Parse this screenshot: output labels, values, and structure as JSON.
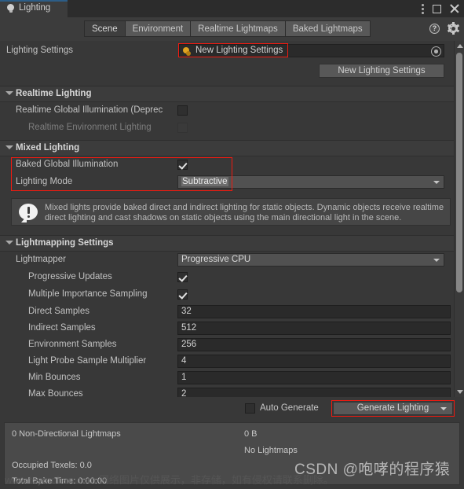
{
  "window": {
    "tab_label": "Lighting",
    "tab_icon": "lightbulb-icon",
    "menu_icon": "kebab-menu-icon",
    "maximize_icon": "maximize-icon",
    "close_icon": "close-icon"
  },
  "toolbar": {
    "tabs": [
      {
        "label": "Scene",
        "selected": true
      },
      {
        "label": "Environment",
        "selected": false
      },
      {
        "label": "Realtime Lightmaps",
        "selected": false
      },
      {
        "label": "Baked Lightmaps",
        "selected": false
      }
    ],
    "help_icon": "help-icon",
    "help_glyph": "?",
    "settings_icon": "gear-icon"
  },
  "lighting_settings": {
    "label": "Lighting Settings",
    "asset_name": "New Lighting Settings",
    "asset_icon": "lighting-settings-asset-icon",
    "picker_icon": "object-picker-icon",
    "new_button": "New Lighting Settings"
  },
  "realtime_lighting": {
    "header": "Realtime Lighting",
    "rows": [
      {
        "label": "Realtime Global Illumination (Deprec",
        "checked": false,
        "disabled": false
      },
      {
        "label": "Realtime Environment Lighting",
        "checked": false,
        "disabled": true
      }
    ]
  },
  "mixed_lighting": {
    "header": "Mixed Lighting",
    "baked_gi_label": "Baked Global Illumination",
    "baked_gi_checked": true,
    "lighting_mode_label": "Lighting Mode",
    "lighting_mode_value": "Subtractive",
    "info_icon": "info-speech-bubble-icon",
    "info_text": "Mixed lights provide baked direct and indirect lighting for static objects. Dynamic objects receive realtime direct lighting and cast shadows on static objects using the main directional light in the scene."
  },
  "lightmapping_settings": {
    "header": "Lightmapping Settings",
    "lightmapper_label": "Lightmapper",
    "lightmapper_value": "Progressive CPU",
    "toggles": [
      {
        "label": "Progressive Updates",
        "checked": true
      },
      {
        "label": "Multiple Importance Sampling",
        "checked": true
      }
    ],
    "fields": [
      {
        "label": "Direct Samples",
        "value": "32"
      },
      {
        "label": "Indirect Samples",
        "value": "512"
      },
      {
        "label": "Environment Samples",
        "value": "256"
      },
      {
        "label": "Light Probe Sample Multiplier",
        "value": "4"
      },
      {
        "label": "Min Bounces",
        "value": "1"
      },
      {
        "label": "Max Bounces",
        "value": "2"
      }
    ]
  },
  "bottom_bar": {
    "auto_generate_label": "Auto Generate",
    "auto_generate_checked": false,
    "generate_button": "Generate Lighting",
    "generate_dropdown_icon": "chevron-down-icon"
  },
  "stats": {
    "lightmaps_count": "0 Non-Directional Lightmaps",
    "size": "0 B",
    "no_lightmaps": "No Lightmaps",
    "occupied_texels": "Occupied Texels: 0.0",
    "total_bake_time": "Total Bake Time: 0:00:00"
  },
  "watermark": {
    "main": "CSDN @咆哮的程序猿",
    "sub": "www.toymoban.com 网络图片仅供展示，非存储，如有侵权请联系删除。"
  },
  "colors": {
    "window_bg": "#383838",
    "header_bg": "#3c3c3c",
    "accent_blue": "#2c5d87",
    "annotation_red": "#f01a10",
    "field_bg": "#2a2a2a",
    "popup_bg": "#515151"
  }
}
